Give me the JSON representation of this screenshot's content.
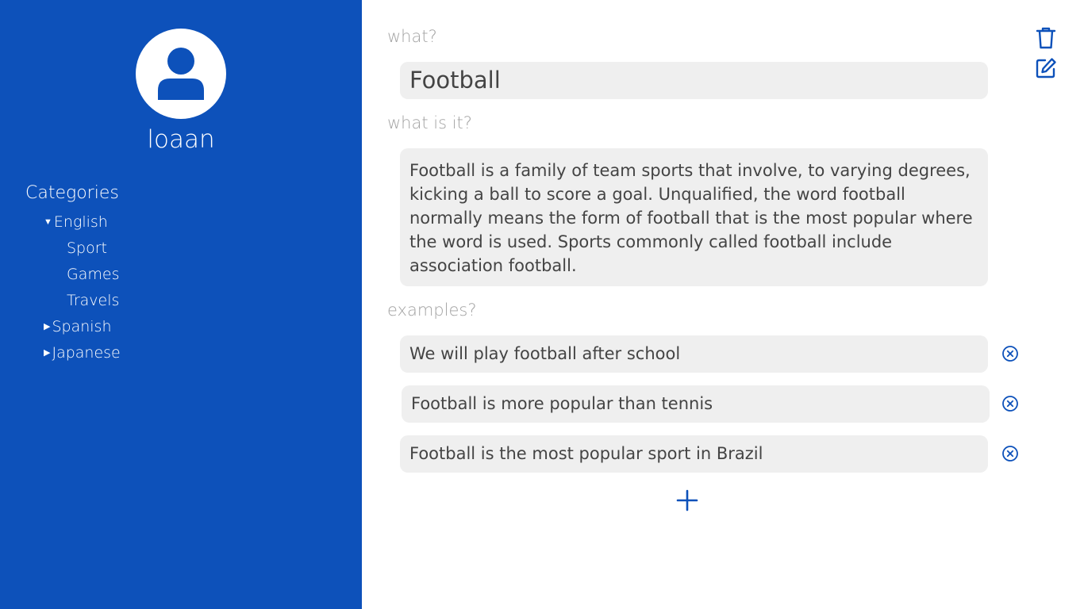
{
  "sidebar": {
    "username": "loaan",
    "categories_label": "Categories",
    "tree": {
      "english": {
        "label": "English",
        "expanded": true,
        "children": [
          "Sport",
          "Games",
          "Travels"
        ]
      },
      "spanish": {
        "label": "Spanish",
        "expanded": false
      },
      "japanese": {
        "label": "Japanese",
        "expanded": false
      }
    },
    "expanded_glyph": "▼",
    "collapsed_glyph": "▶"
  },
  "toolbar": {
    "delete_icon": "trash-icon",
    "edit_icon": "edit-icon"
  },
  "card": {
    "what_label": "what?",
    "what_value": "Football",
    "what_is_it_label": "what is it?",
    "description": "Football is a family of team sports that involve, to varying degrees, kicking a ball to score a goal. Unqualified, the word football normally means the form of football that is the most popular where the word is used. Sports commonly called football include association football.",
    "examples_label": "examples?",
    "examples": [
      "We will play football after school",
      "Football is more popular than tennis",
      "Football is the most popular sport in Brazil"
    ],
    "remove_icon": "close-circle-icon",
    "add_icon": "plus-icon"
  },
  "colors": {
    "sidebar_bg": "#0d51ba",
    "accent": "#0d51ba",
    "field_bg": "#efefef",
    "label_text": "#a2a2a2",
    "field_text": "#444444"
  }
}
